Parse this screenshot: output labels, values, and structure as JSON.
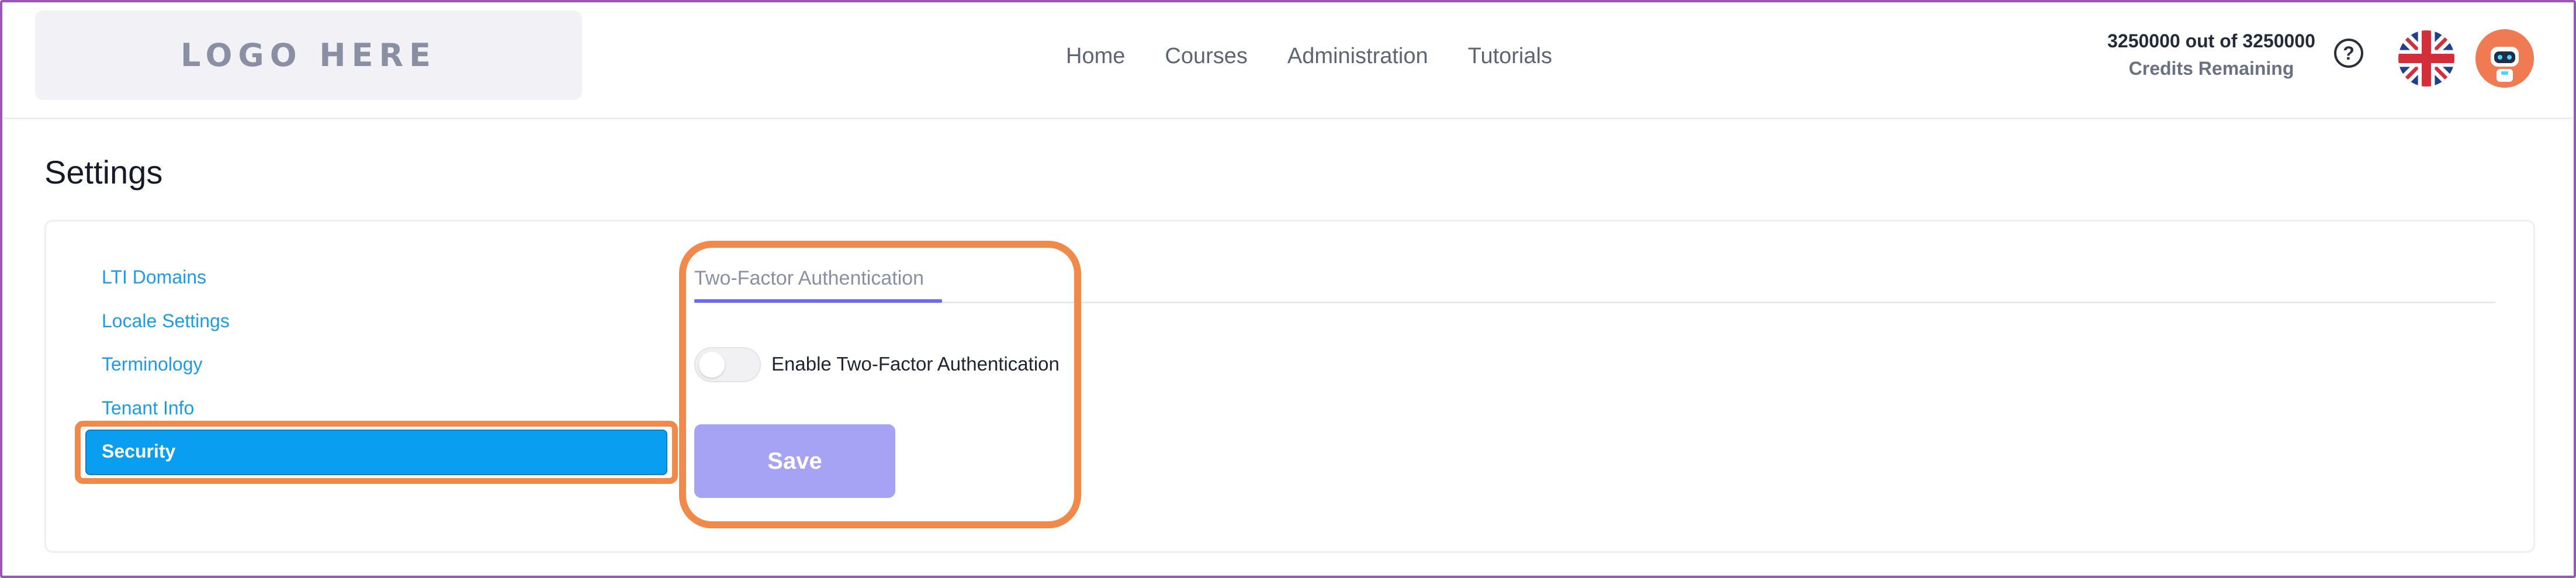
{
  "header": {
    "logo_text": "LOGO HERE",
    "nav": [
      "Home",
      "Courses",
      "Administration",
      "Tutorials"
    ],
    "credits_line1": "3250000 out of 3250000",
    "credits_line2": "Credits Remaining",
    "help_symbol": "?"
  },
  "page": {
    "title": "Settings"
  },
  "sidebar": {
    "items": [
      {
        "label": "LTI Domains",
        "active": false
      },
      {
        "label": "Locale Settings",
        "active": false
      },
      {
        "label": "Terminology",
        "active": false
      },
      {
        "label": "Tenant Info",
        "active": false
      },
      {
        "label": "Security",
        "active": true
      }
    ]
  },
  "content": {
    "tab_label": "Two-Factor Authentication",
    "toggle_label": "Enable Two-Factor Authentication",
    "toggle_enabled": false,
    "save_label": "Save"
  },
  "colors": {
    "accent_blue": "#0a9ef1",
    "link_blue": "#1e9be6",
    "highlight_orange": "#f0894a",
    "save_disabled": "#a6a3f4",
    "tab_underline": "#6a6cf0",
    "frame_purple": "#9b59b6"
  },
  "icons": [
    "help-icon",
    "uk-flag-icon",
    "robot-avatar-icon"
  ]
}
